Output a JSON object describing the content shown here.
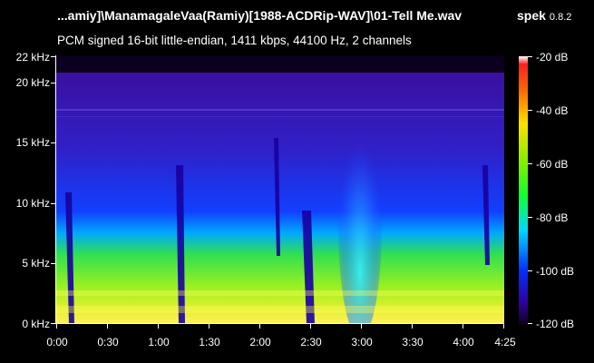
{
  "header": {
    "file_title": "...amiy]\\ManamagaleVaa(Ramiy)[1988-ACDRip-WAV]\\01-Tell Me.wav",
    "app_name": "spek",
    "app_version": "0.8.2",
    "stream_info": "PCM signed 16-bit little-endian, 1411 kbps, 44100 Hz, 2 channels"
  },
  "axes": {
    "y_labels": [
      "0 kHz",
      "5 kHz",
      "10 kHz",
      "15 kHz",
      "20 kHz",
      "22 kHz"
    ],
    "x_labels": [
      "0:00",
      "0:30",
      "1:00",
      "1:30",
      "2:00",
      "2:30",
      "3:00",
      "3:30",
      "4:00",
      "4:25"
    ],
    "colorbar_labels": [
      "-20 dB",
      "-40 dB",
      "-60 dB",
      "-80 dB",
      "-100 dB",
      "-120 dB"
    ]
  },
  "colors": {
    "background": "#000000",
    "loud": "#ffe000",
    "mid": "#10ff30",
    "quiet": "#0030ff",
    "floor": "#10002a"
  }
}
